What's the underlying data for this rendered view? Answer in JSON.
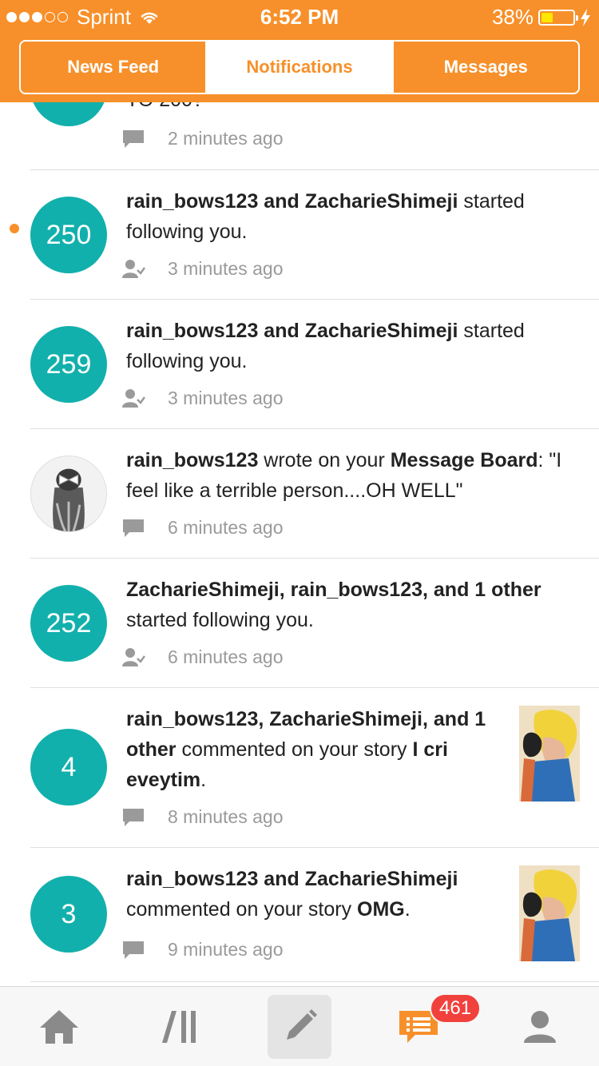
{
  "status_bar": {
    "carrier": "Sprint",
    "time": "6:52 PM",
    "battery_percent": "38%",
    "battery_level": 0.38,
    "signal_bars_filled": 3
  },
  "tabs": [
    {
      "label": "News Feed",
      "active": false
    },
    {
      "label": "Notifications",
      "active": true
    },
    {
      "label": "Messages",
      "active": false
    }
  ],
  "notifications": {
    "partial_top": {
      "text": "TO 200?",
      "time": "2 minutes ago",
      "icon": "comment-icon"
    },
    "items": [
      {
        "badge": "250",
        "unread": true,
        "line1_user": "rain_bows123 and ZacharieShimeji",
        "line1_rest": " started",
        "line2": "following you.",
        "time": "3 minutes ago",
        "icon": "follow-icon"
      },
      {
        "badge": "259",
        "unread": false,
        "line1_user": "rain_bows123 and ZacharieShimeji",
        "line1_rest": " started",
        "line2": "following you.",
        "time": "3 minutes ago",
        "icon": "follow-icon"
      },
      {
        "badge": "",
        "unread": false,
        "user": "rain_bows123",
        "mid": " wrote on your ",
        "target": "Message Board",
        "tail": ": \"I",
        "line2": "feel like a terrible person....OH WELL\"",
        "time": "6 minutes ago",
        "icon": "comment-icon"
      },
      {
        "badge": "252",
        "unread": false,
        "line1_user": "ZacharieShimeji, rain_bows123, and 1 other",
        "line2": "started following you.",
        "time": "6 minutes ago",
        "icon": "follow-icon"
      },
      {
        "badge": "4",
        "unread": false,
        "line1": "rain_bows123, ZacharieShimeji, and 1",
        "line2_bold": "other",
        "line2_rest": " commented on your story ",
        "line2_story": "I cri",
        "line3_story": "eveytim",
        "line3_tail": ".",
        "time": "8 minutes ago",
        "icon": "comment-icon"
      },
      {
        "badge": "3",
        "unread": false,
        "line1": "rain_bows123 and ZacharieShimeji",
        "line2_rest": "commented on your story ",
        "line2_story": "OMG",
        "line2_tail": ".",
        "time": "9 minutes ago",
        "icon": "comment-icon"
      }
    ]
  },
  "tabbar": {
    "items": [
      "home-icon",
      "library-icon",
      "write-icon",
      "notifications-icon",
      "profile-icon"
    ],
    "badge": "461"
  },
  "colors": {
    "accent": "#f7902a",
    "teal": "#12b0ac",
    "badge_red": "#f1413c"
  }
}
